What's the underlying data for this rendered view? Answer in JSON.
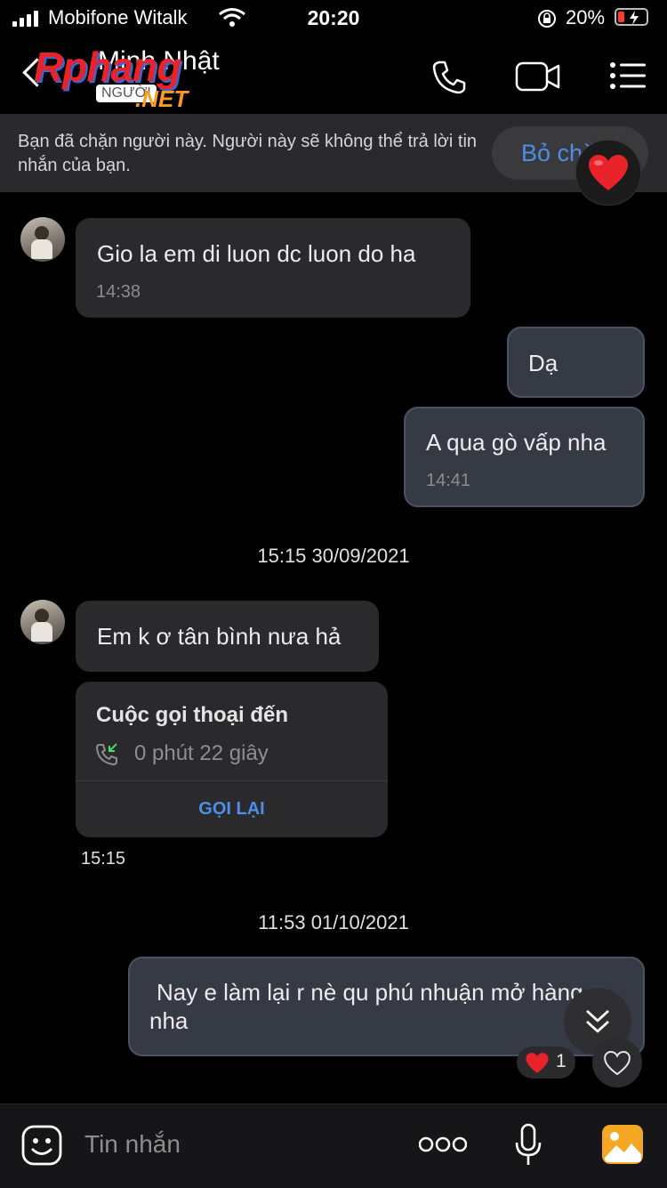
{
  "status_bar": {
    "carrier": "Mobifone Witalk",
    "time": "20:20",
    "battery": "20%"
  },
  "header": {
    "contact_name": "Minh Nhật",
    "watermark": {
      "brand": "Rphang",
      "sub": "NGƯỜI",
      "domain": ".NET"
    }
  },
  "banner": {
    "text": "Bạn đã chặn người này. Người này sẽ không thể trả lời tin nhắn của bạn.",
    "button": "Bỏ chặn"
  },
  "messages": [
    {
      "from": "them",
      "text": "Gio la em di luon dc luon do ha",
      "time": "14:38"
    },
    {
      "from": "me",
      "text": "Dạ"
    },
    {
      "from": "me",
      "text": "A qua gò vấp nha",
      "time": "14:41"
    },
    {
      "separator": "15:15 30/09/2021"
    },
    {
      "from": "them",
      "text": "Em k ơ tân bình nưa hả"
    },
    {
      "from": "them",
      "call": {
        "title": "Cuộc gọi thoại đến",
        "duration": "0 phút 22 giây",
        "action": "GỌI LẠI"
      },
      "time": "15:15"
    },
    {
      "separator": "11:53 01/10/2021"
    },
    {
      "from": "me",
      "text": "Nay e làm lại r nè qu phú nhuận mở hàng e nha",
      "reaction_count": "1"
    }
  ],
  "composer": {
    "placeholder": "Tin nhắn"
  },
  "icons": {
    "header": [
      "back-icon",
      "phone-icon",
      "video-icon",
      "menu-icon"
    ],
    "composer": [
      "sticker-icon",
      "more-icon",
      "mic-icon",
      "image-icon"
    ]
  },
  "colors": {
    "background": "#000000",
    "bubble_them": "#2a2a2c",
    "bubble_me": "#353a44",
    "accent_blue": "#4d8fe6",
    "heart_red": "#e8232a"
  }
}
